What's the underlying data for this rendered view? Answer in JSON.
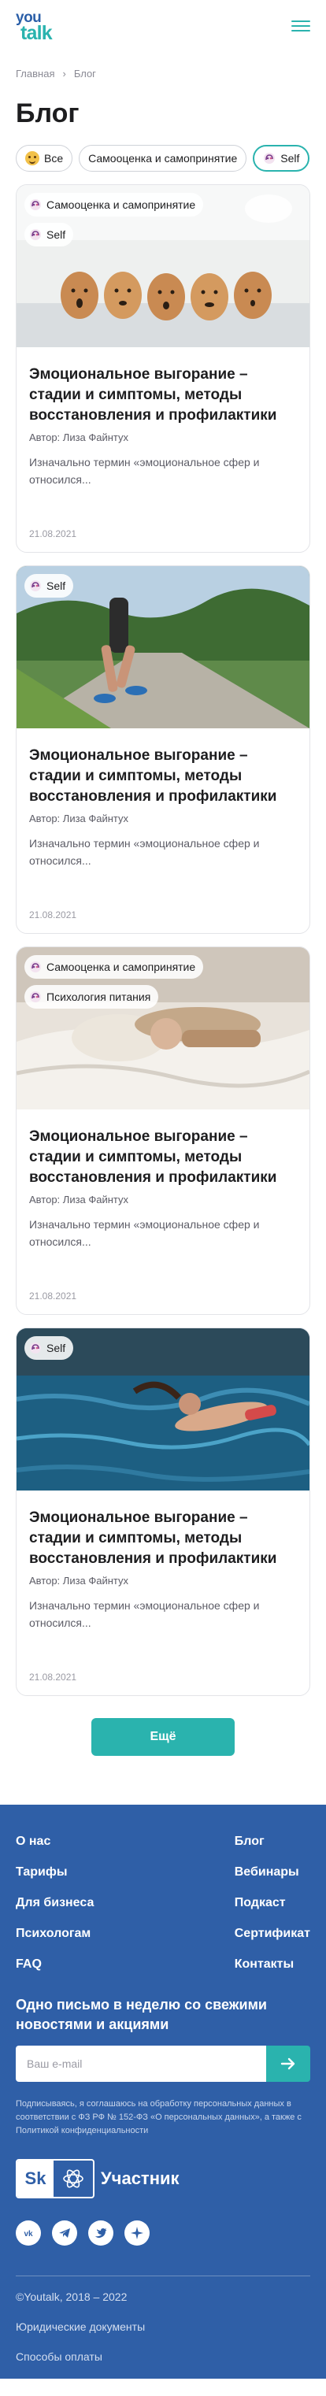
{
  "header": {
    "logo_top": "you",
    "logo_bottom": "talk",
    "menu_icon": "hamburger-icon"
  },
  "breadcrumb": {
    "home": "Главная",
    "current": "Блог",
    "separator_icon": "chevron-right-icon"
  },
  "page_title": "Блог",
  "filters": [
    {
      "label": "Все",
      "icon": "smiling-face-emoji",
      "active": false
    },
    {
      "label": "Самооценка и самопринятие",
      "icon": "",
      "active": false
    },
    {
      "label": "Self",
      "icon": "brain-icon",
      "active": true
    }
  ],
  "cards": [
    {
      "tags": [
        "Самооценка и самопринятие",
        "Self"
      ],
      "image": "eggs-with-drawn-faces",
      "title": "Эмоциональное выгорание – стадии и симптомы, методы восстановления и профилактики",
      "author": "Автор: Лиза Файнтух",
      "excerpt": "Изначально термин «эмоциональное сфер и относился...",
      "date": "21.08.2021"
    },
    {
      "tags": [
        "Self"
      ],
      "image": "runner-on-path",
      "title": "Эмоциональное выгорание – стадии и симптомы, методы восстановления и профилактики",
      "author": "Автор: Лиза Файнтух",
      "excerpt": "Изначально термин «эмоциональное сфер и относился...",
      "date": "21.08.2021"
    },
    {
      "tags": [
        "Самооценка и самопринятие",
        "Психология питания"
      ],
      "image": "woman-lying-on-bed",
      "title": "Эмоциональное выгорание – стадии и симптомы, методы восстановления и профилактики",
      "author": "Автор: Лиза Файнтух",
      "excerpt": "Изначально термин «эмоциональное сфер и относился...",
      "date": "21.08.2021"
    },
    {
      "tags": [
        "Self"
      ],
      "image": "woman-floating-in-water",
      "title": "Эмоциональное выгорание – стадии и симптомы, методы восстановления и профилактики",
      "author": "Автор: Лиза Файнтух",
      "excerpt": "Изначально термин «эмоциональное сфер и относился...",
      "date": "21.08.2021"
    }
  ],
  "more_button": "Ещё",
  "footer": {
    "nav": [
      [
        "О нас",
        "Блог"
      ],
      [
        "Тарифы",
        "Вебинары"
      ],
      [
        "Для бизнеса",
        "Подкаст"
      ],
      [
        "Психологам",
        "Сертификат"
      ],
      [
        "FAQ",
        "Контакты"
      ]
    ],
    "newsletter_title": "Одно письмо в неделю со свежими новостями и акциями",
    "email_placeholder": "Ваш e-mail",
    "consent": "Подписываясь, я соглашаюсь на обработку персональных данных в соответствии с ФЗ РФ № 152-ФЗ «О персональных данных», а также с Политикой конфиденциальности",
    "skolkovo_logo": "Sk",
    "skolkovo_label": "Участник",
    "socials": [
      "vk-icon",
      "telegram-icon",
      "twitter-icon",
      "star-icon"
    ],
    "copyright": "©Youtalk, 2018 – 2022",
    "legal": "Юридические документы",
    "payment": "Способы оплаты"
  },
  "colors": {
    "brand_blue": "#2f5fa7",
    "brand_teal": "#2ab3ae",
    "text": "#1d1d1f",
    "muted": "#5c5c66"
  }
}
